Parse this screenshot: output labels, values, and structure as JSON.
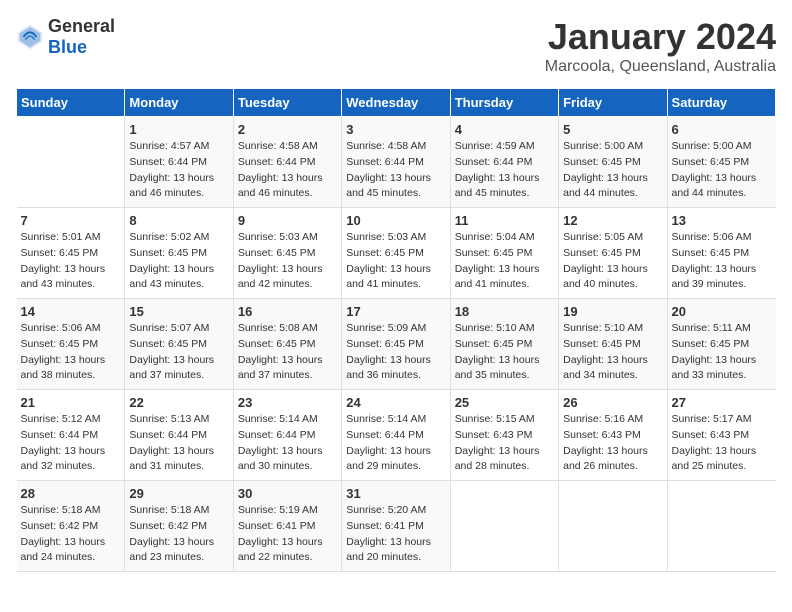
{
  "logo": {
    "general": "General",
    "blue": "Blue"
  },
  "title": "January 2024",
  "subtitle": "Marcoola, Queensland, Australia",
  "headers": [
    "Sunday",
    "Monday",
    "Tuesday",
    "Wednesday",
    "Thursday",
    "Friday",
    "Saturday"
  ],
  "weeks": [
    [
      {
        "day": "",
        "sunrise": "",
        "sunset": "",
        "daylight": ""
      },
      {
        "day": "1",
        "sunrise": "Sunrise: 4:57 AM",
        "sunset": "Sunset: 6:44 PM",
        "daylight": "Daylight: 13 hours and 46 minutes."
      },
      {
        "day": "2",
        "sunrise": "Sunrise: 4:58 AM",
        "sunset": "Sunset: 6:44 PM",
        "daylight": "Daylight: 13 hours and 46 minutes."
      },
      {
        "day": "3",
        "sunrise": "Sunrise: 4:58 AM",
        "sunset": "Sunset: 6:44 PM",
        "daylight": "Daylight: 13 hours and 45 minutes."
      },
      {
        "day": "4",
        "sunrise": "Sunrise: 4:59 AM",
        "sunset": "Sunset: 6:44 PM",
        "daylight": "Daylight: 13 hours and 45 minutes."
      },
      {
        "day": "5",
        "sunrise": "Sunrise: 5:00 AM",
        "sunset": "Sunset: 6:45 PM",
        "daylight": "Daylight: 13 hours and 44 minutes."
      },
      {
        "day": "6",
        "sunrise": "Sunrise: 5:00 AM",
        "sunset": "Sunset: 6:45 PM",
        "daylight": "Daylight: 13 hours and 44 minutes."
      }
    ],
    [
      {
        "day": "7",
        "sunrise": "Sunrise: 5:01 AM",
        "sunset": "Sunset: 6:45 PM",
        "daylight": "Daylight: 13 hours and 43 minutes."
      },
      {
        "day": "8",
        "sunrise": "Sunrise: 5:02 AM",
        "sunset": "Sunset: 6:45 PM",
        "daylight": "Daylight: 13 hours and 43 minutes."
      },
      {
        "day": "9",
        "sunrise": "Sunrise: 5:03 AM",
        "sunset": "Sunset: 6:45 PM",
        "daylight": "Daylight: 13 hours and 42 minutes."
      },
      {
        "day": "10",
        "sunrise": "Sunrise: 5:03 AM",
        "sunset": "Sunset: 6:45 PM",
        "daylight": "Daylight: 13 hours and 41 minutes."
      },
      {
        "day": "11",
        "sunrise": "Sunrise: 5:04 AM",
        "sunset": "Sunset: 6:45 PM",
        "daylight": "Daylight: 13 hours and 41 minutes."
      },
      {
        "day": "12",
        "sunrise": "Sunrise: 5:05 AM",
        "sunset": "Sunset: 6:45 PM",
        "daylight": "Daylight: 13 hours and 40 minutes."
      },
      {
        "day": "13",
        "sunrise": "Sunrise: 5:06 AM",
        "sunset": "Sunset: 6:45 PM",
        "daylight": "Daylight: 13 hours and 39 minutes."
      }
    ],
    [
      {
        "day": "14",
        "sunrise": "Sunrise: 5:06 AM",
        "sunset": "Sunset: 6:45 PM",
        "daylight": "Daylight: 13 hours and 38 minutes."
      },
      {
        "day": "15",
        "sunrise": "Sunrise: 5:07 AM",
        "sunset": "Sunset: 6:45 PM",
        "daylight": "Daylight: 13 hours and 37 minutes."
      },
      {
        "day": "16",
        "sunrise": "Sunrise: 5:08 AM",
        "sunset": "Sunset: 6:45 PM",
        "daylight": "Daylight: 13 hours and 37 minutes."
      },
      {
        "day": "17",
        "sunrise": "Sunrise: 5:09 AM",
        "sunset": "Sunset: 6:45 PM",
        "daylight": "Daylight: 13 hours and 36 minutes."
      },
      {
        "day": "18",
        "sunrise": "Sunrise: 5:10 AM",
        "sunset": "Sunset: 6:45 PM",
        "daylight": "Daylight: 13 hours and 35 minutes."
      },
      {
        "day": "19",
        "sunrise": "Sunrise: 5:10 AM",
        "sunset": "Sunset: 6:45 PM",
        "daylight": "Daylight: 13 hours and 34 minutes."
      },
      {
        "day": "20",
        "sunrise": "Sunrise: 5:11 AM",
        "sunset": "Sunset: 6:45 PM",
        "daylight": "Daylight: 13 hours and 33 minutes."
      }
    ],
    [
      {
        "day": "21",
        "sunrise": "Sunrise: 5:12 AM",
        "sunset": "Sunset: 6:44 PM",
        "daylight": "Daylight: 13 hours and 32 minutes."
      },
      {
        "day": "22",
        "sunrise": "Sunrise: 5:13 AM",
        "sunset": "Sunset: 6:44 PM",
        "daylight": "Daylight: 13 hours and 31 minutes."
      },
      {
        "day": "23",
        "sunrise": "Sunrise: 5:14 AM",
        "sunset": "Sunset: 6:44 PM",
        "daylight": "Daylight: 13 hours and 30 minutes."
      },
      {
        "day": "24",
        "sunrise": "Sunrise: 5:14 AM",
        "sunset": "Sunset: 6:44 PM",
        "daylight": "Daylight: 13 hours and 29 minutes."
      },
      {
        "day": "25",
        "sunrise": "Sunrise: 5:15 AM",
        "sunset": "Sunset: 6:43 PM",
        "daylight": "Daylight: 13 hours and 28 minutes."
      },
      {
        "day": "26",
        "sunrise": "Sunrise: 5:16 AM",
        "sunset": "Sunset: 6:43 PM",
        "daylight": "Daylight: 13 hours and 26 minutes."
      },
      {
        "day": "27",
        "sunrise": "Sunrise: 5:17 AM",
        "sunset": "Sunset: 6:43 PM",
        "daylight": "Daylight: 13 hours and 25 minutes."
      }
    ],
    [
      {
        "day": "28",
        "sunrise": "Sunrise: 5:18 AM",
        "sunset": "Sunset: 6:42 PM",
        "daylight": "Daylight: 13 hours and 24 minutes."
      },
      {
        "day": "29",
        "sunrise": "Sunrise: 5:18 AM",
        "sunset": "Sunset: 6:42 PM",
        "daylight": "Daylight: 13 hours and 23 minutes."
      },
      {
        "day": "30",
        "sunrise": "Sunrise: 5:19 AM",
        "sunset": "Sunset: 6:41 PM",
        "daylight": "Daylight: 13 hours and 22 minutes."
      },
      {
        "day": "31",
        "sunrise": "Sunrise: 5:20 AM",
        "sunset": "Sunset: 6:41 PM",
        "daylight": "Daylight: 13 hours and 20 minutes."
      },
      {
        "day": "",
        "sunrise": "",
        "sunset": "",
        "daylight": ""
      },
      {
        "day": "",
        "sunrise": "",
        "sunset": "",
        "daylight": ""
      },
      {
        "day": "",
        "sunrise": "",
        "sunset": "",
        "daylight": ""
      }
    ]
  ]
}
